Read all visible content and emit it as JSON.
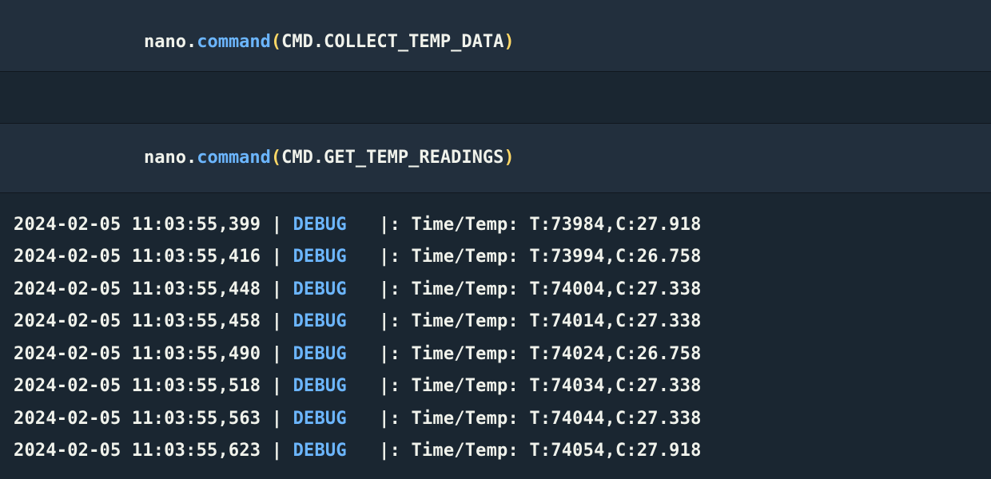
{
  "cells": [
    {
      "tokens": {
        "obj": "nano",
        "dot1": ".",
        "method": "command",
        "openParen": "(",
        "cls": "CMD",
        "dot2": ".",
        "attr": "COLLECT_TEMP_DATA",
        "closeParen": ")"
      }
    },
    {
      "tokens": {
        "obj": "nano",
        "dot1": ".",
        "method": "command",
        "openParen": "(",
        "cls": "CMD",
        "dot2": ".",
        "attr": "GET_TEMP_READINGS",
        "closeParen": ")"
      }
    }
  ],
  "log_sep1": " | ",
  "log_sep2": "   |: ",
  "logs": [
    {
      "ts": "2024-02-05 11:03:55,399",
      "level": "DEBUG",
      "body": "Time/Temp: T:73984,C:27.918"
    },
    {
      "ts": "2024-02-05 11:03:55,416",
      "level": "DEBUG",
      "body": "Time/Temp: T:73994,C:26.758"
    },
    {
      "ts": "2024-02-05 11:03:55,448",
      "level": "DEBUG",
      "body": "Time/Temp: T:74004,C:27.338"
    },
    {
      "ts": "2024-02-05 11:03:55,458",
      "level": "DEBUG",
      "body": "Time/Temp: T:74014,C:27.338"
    },
    {
      "ts": "2024-02-05 11:03:55,490",
      "level": "DEBUG",
      "body": "Time/Temp: T:74024,C:26.758"
    },
    {
      "ts": "2024-02-05 11:03:55,518",
      "level": "DEBUG",
      "body": "Time/Temp: T:74034,C:27.338"
    },
    {
      "ts": "2024-02-05 11:03:55,563",
      "level": "DEBUG",
      "body": "Time/Temp: T:74044,C:27.338"
    },
    {
      "ts": "2024-02-05 11:03:55,623",
      "level": "DEBUG",
      "body": "Time/Temp: T:74054,C:27.918"
    }
  ]
}
